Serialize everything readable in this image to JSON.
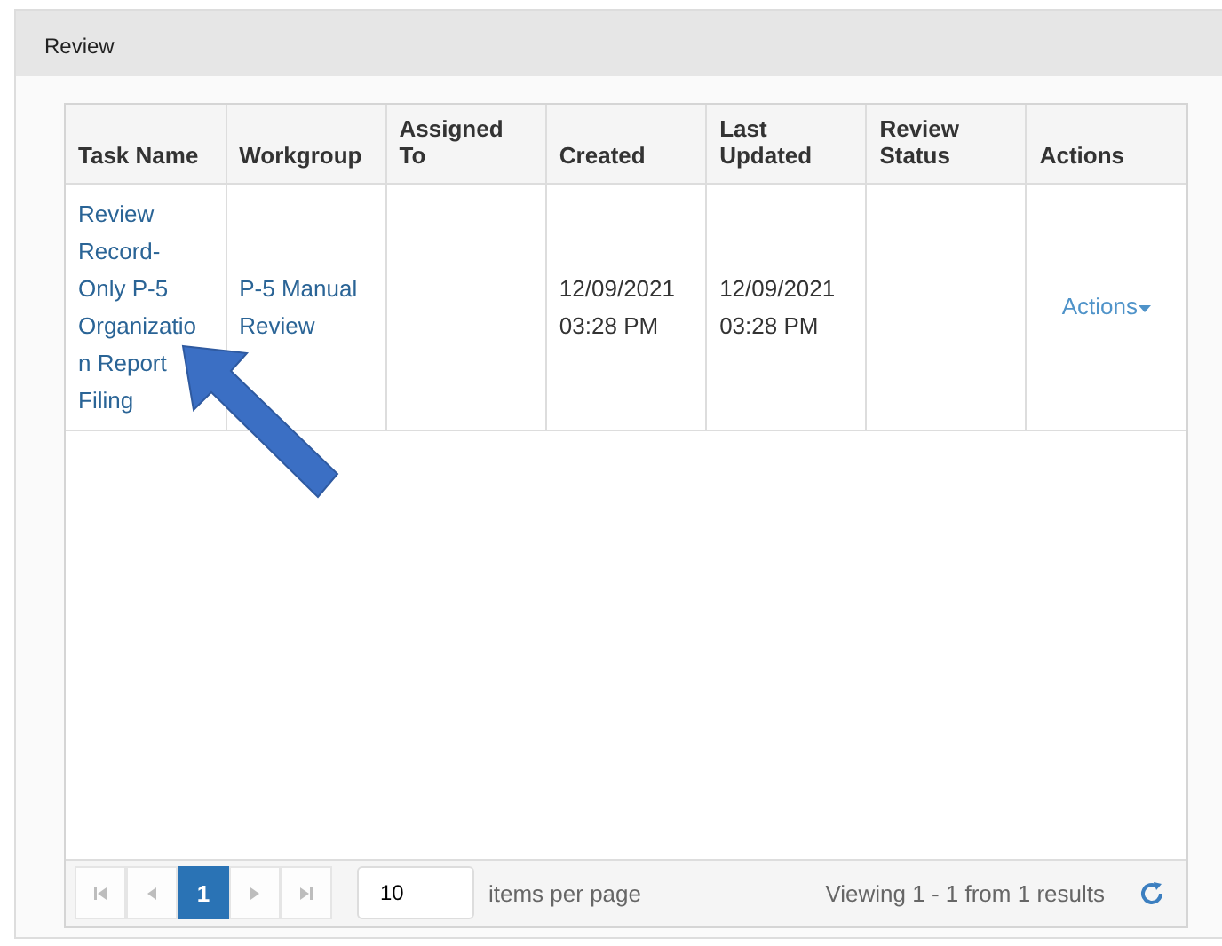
{
  "panel": {
    "title": "Review"
  },
  "table": {
    "columns": [
      "Task Name",
      "Workgroup",
      "Assigned To",
      "Created",
      "Last Updated",
      "Review Status",
      "Actions"
    ],
    "rows": [
      {
        "task_name": [
          "Review",
          "Record-",
          "Only P-5",
          "Organizatio",
          "n Report",
          "Filing"
        ],
        "workgroup": [
          "P-5 Manual",
          "Review"
        ],
        "created": "12/09/2021 03:28 PM",
        "last_updated": "12/09/2021 03:28 PM",
        "actions": "Actions"
      }
    ]
  },
  "pager": {
    "buttons": [
      {
        "kind": "first",
        "disabled": true
      },
      {
        "kind": "prev",
        "disabled": true
      },
      {
        "kind": "page",
        "label": "1",
        "selected": true
      },
      {
        "kind": "next",
        "disabled": true
      },
      {
        "kind": "last",
        "disabled": true
      }
    ],
    "page_size": "10",
    "page_size_label": "items per page",
    "info": "Viewing 1 - 1 from 1 results"
  }
}
